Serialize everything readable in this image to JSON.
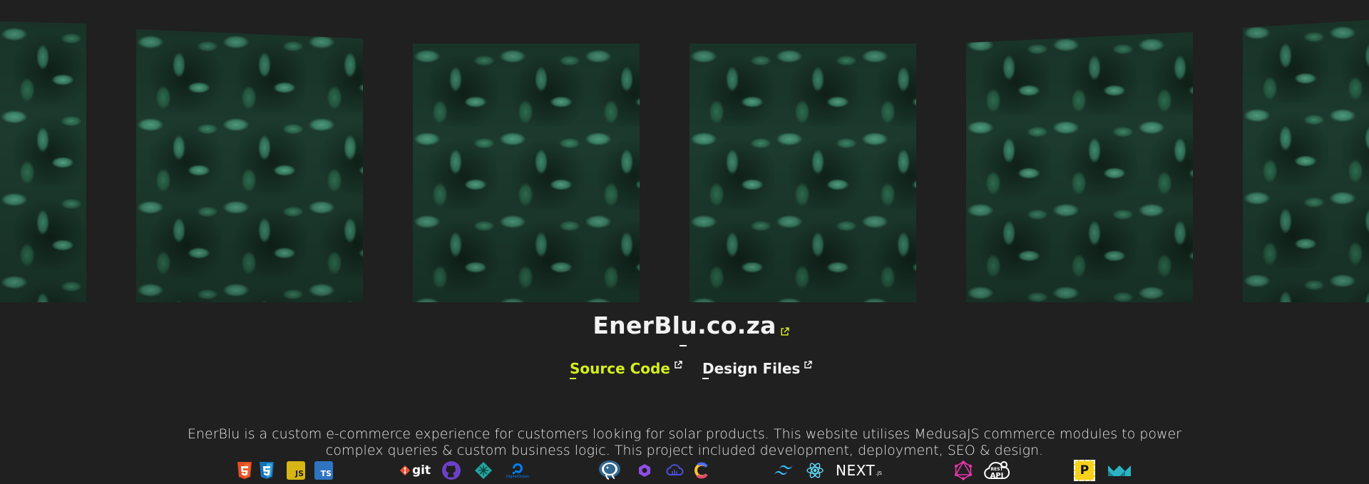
{
  "project": {
    "title": "EnerBlu.co.za",
    "links": [
      {
        "label": "Source Code"
      },
      {
        "label": "Design Files"
      }
    ],
    "description": "EnerBlu is a custom e-commerce experience for customers looking for solar products. This website utilises MedusaJS commerce modules to power complex queries & custom business logic. This project included development, deployment, SEO & design."
  },
  "carousel": {
    "slides": [
      "leaves-image",
      "leaves-image",
      "leaves-image",
      "leaves-image",
      "leaves-image",
      "leaves-image"
    ]
  },
  "tech_icons": {
    "html5": "html5-icon",
    "css3": "css3-icon",
    "js_label": "JS",
    "ts_label": "TS",
    "git_label": "git",
    "github": "github-icon",
    "netlify": "netlify-icon",
    "digitalocean_label": "DigitalOcean",
    "postgres": "postgresql-icon",
    "medusa": "medusa-icon",
    "cloud": "cloud-icon",
    "c": "c-icon",
    "tailwind": "tailwind-icon",
    "react": "react-icon",
    "next_label": "NEXT",
    "next_sub": ".JS",
    "graphql": "graphql-icon",
    "rest_label": "REST",
    "api_label": "API",
    "p_label": "P",
    "m": "m-logo-icon"
  },
  "colors": {
    "background": "#202020",
    "accent": "#d4f01c",
    "text": "#f2f2f2"
  }
}
